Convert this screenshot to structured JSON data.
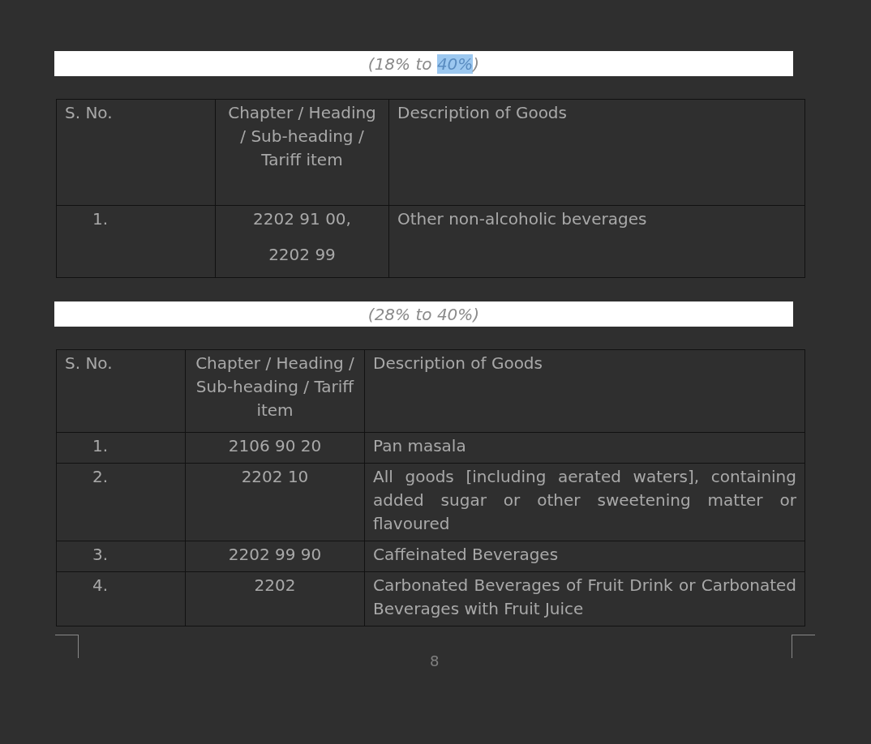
{
  "sections": [
    {
      "caption": [
        {
          "text": "(18% to ",
          "selected": false
        },
        {
          "text": "40%",
          "selected": true
        },
        {
          "text": ")",
          "selected": false
        }
      ],
      "columns": [
        "S. No.",
        "Chapter / Heading / Sub-heading / Tariff item",
        "Description of Goods"
      ],
      "rows": [
        {
          "s_no": "1.",
          "codes": [
            "2202 91 00,",
            "2202 99"
          ],
          "description": "Other non-alcoholic beverages"
        }
      ]
    },
    {
      "caption": [
        {
          "text": "(28% to 40%)",
          "selected": false
        }
      ],
      "columns": [
        "S. No.",
        "Chapter / Heading / Sub-heading / Tariff item",
        "Description of Goods"
      ],
      "rows": [
        {
          "s_no": "1.",
          "codes": [
            "2106 90 20"
          ],
          "description": "Pan masala"
        },
        {
          "s_no": "2.",
          "codes": [
            "2202 10"
          ],
          "description": "All goods [including aerated waters], containing added sugar or other sweetening matter or flavoured"
        },
        {
          "s_no": "3.",
          "codes": [
            "2202 99 90"
          ],
          "description": "Caffeinated Beverages"
        },
        {
          "s_no": "4.",
          "codes": [
            "2202"
          ],
          "description": "Carbonated Beverages of Fruit Drink or Carbonated Beverages with Fruit Juice"
        }
      ]
    }
  ],
  "page_number": "8"
}
